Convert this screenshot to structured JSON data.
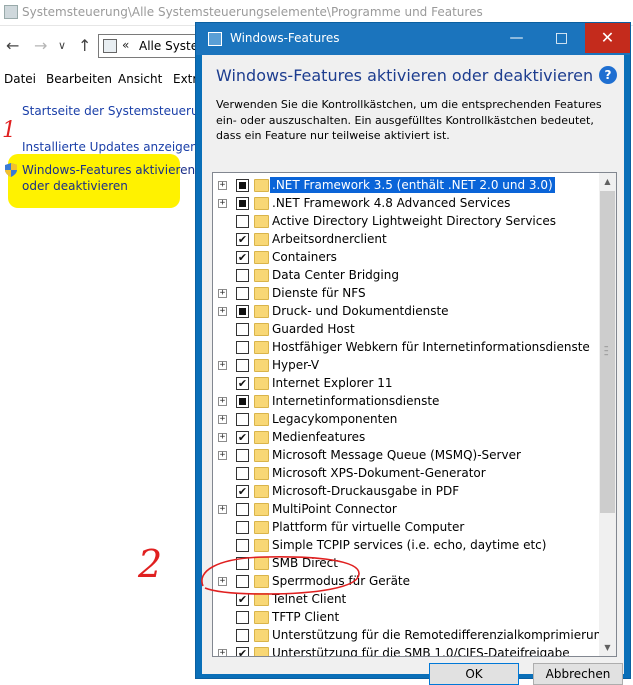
{
  "background_window": {
    "title": "Systemsteuerung\\Alle Systemsteuerungselemente\\Programme und Features",
    "address": "Alle Syster",
    "address_chevron": "«",
    "menu": [
      "Datei",
      "Bearbeiten",
      "Ansicht",
      "Extr"
    ],
    "links": {
      "home": "Startseite der Systemsteuerung",
      "updates": "Installierte Updates anzeigen",
      "features_line1": "Windows-Features aktivieren",
      "features_line2": "oder deaktivieren"
    },
    "annotations": {
      "mark_1": "1",
      "mark_2": "2"
    },
    "highlight_color": "#fff200"
  },
  "dialog": {
    "title": "Windows-Features",
    "heading": "Windows-Features aktivieren oder deaktivieren",
    "description": "Verwenden Sie die Kontrollkästchen, um die entsprechenden Features ein- oder auszuschalten. Ein ausgefülltes Kontrollkästchen bedeutet, dass ein Feature nur teilweise aktiviert ist.",
    "ok": "OK",
    "cancel": "Abbrechen",
    "accent": "#1b74bd",
    "features": [
      {
        "label": ".NET Framework 3.5 (enthält .NET 2.0 und 3.0)",
        "state": "partial",
        "expandable": true,
        "selected": true
      },
      {
        "label": ".NET Framework 4.8 Advanced Services",
        "state": "partial",
        "expandable": true
      },
      {
        "label": "Active Directory Lightweight Directory Services",
        "state": "unchecked",
        "expandable": false
      },
      {
        "label": "Arbeitsordnerclient",
        "state": "checked",
        "expandable": false
      },
      {
        "label": "Containers",
        "state": "checked",
        "expandable": false
      },
      {
        "label": "Data Center Bridging",
        "state": "unchecked",
        "expandable": false
      },
      {
        "label": "Dienste für NFS",
        "state": "unchecked",
        "expandable": true
      },
      {
        "label": "Druck- und Dokumentdienste",
        "state": "partial",
        "expandable": true
      },
      {
        "label": "Guarded Host",
        "state": "unchecked",
        "expandable": false
      },
      {
        "label": "Hostfähiger Webkern für Internetinformationsdienste",
        "state": "unchecked",
        "expandable": false
      },
      {
        "label": "Hyper-V",
        "state": "unchecked",
        "expandable": true
      },
      {
        "label": "Internet Explorer 11",
        "state": "checked",
        "expandable": false
      },
      {
        "label": "Internetinformationsdienste",
        "state": "partial",
        "expandable": true
      },
      {
        "label": "Legacykomponenten",
        "state": "unchecked",
        "expandable": true
      },
      {
        "label": "Medienfeatures",
        "state": "checked",
        "expandable": true
      },
      {
        "label": "Microsoft Message Queue (MSMQ)-Server",
        "state": "unchecked",
        "expandable": true
      },
      {
        "label": "Microsoft XPS-Dokument-Generator",
        "state": "unchecked",
        "expandable": false
      },
      {
        "label": "Microsoft-Druckausgabe in PDF",
        "state": "checked",
        "expandable": false
      },
      {
        "label": "MultiPoint Connector",
        "state": "unchecked",
        "expandable": true
      },
      {
        "label": "Plattform für virtuelle Computer",
        "state": "unchecked",
        "expandable": false
      },
      {
        "label": "Simple TCPIP services (i.e. echo, daytime etc)",
        "state": "unchecked",
        "expandable": false
      },
      {
        "label": "SMB Direct",
        "state": "unchecked",
        "expandable": false
      },
      {
        "label": "Sperrmodus für Geräte",
        "state": "unchecked",
        "expandable": true
      },
      {
        "label": "Telnet Client",
        "state": "checked",
        "expandable": false
      },
      {
        "label": "TFTP Client",
        "state": "unchecked",
        "expandable": false
      },
      {
        "label": "Unterstützung für die Remotedifferenzialkomprimierungs-API",
        "state": "unchecked",
        "expandable": false
      },
      {
        "label": "Unterstützung für die SMB 1.0/CIFS-Dateifreigabe",
        "state": "checked",
        "expandable": true
      }
    ]
  }
}
